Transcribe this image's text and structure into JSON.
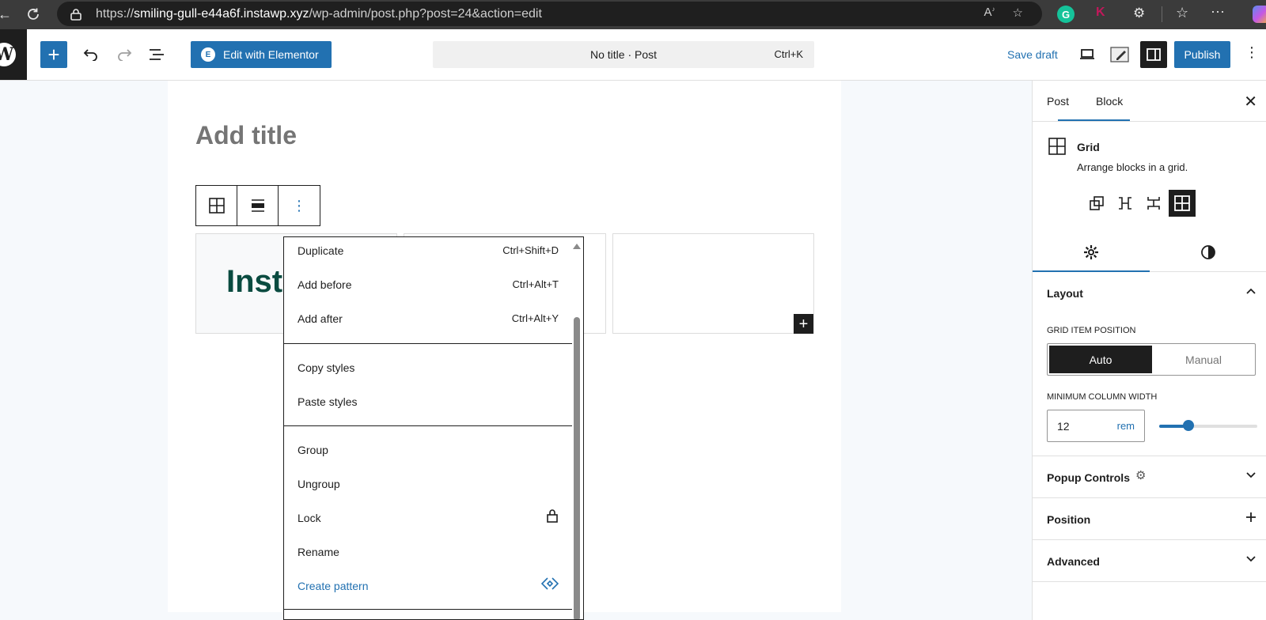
{
  "browser": {
    "url_prefix": "https://",
    "url_host": "smiling-gull-e44a6f.instawp.xyz",
    "url_path": "/wp-admin/post.php?post=24&action=edit"
  },
  "header": {
    "elementor_label": "Edit with Elementor",
    "doc_title": "No title · Post",
    "doc_shortcut": "Ctrl+K",
    "save_draft": "Save draft",
    "publish": "Publish"
  },
  "editor": {
    "title_placeholder": "Add title",
    "cell_heading": "Inst"
  },
  "menu": {
    "items": [
      {
        "label": "Duplicate",
        "shortcut": "Ctrl+Shift+D"
      },
      {
        "label": "Add before",
        "shortcut": "Ctrl+Alt+T"
      },
      {
        "label": "Add after",
        "shortcut": "Ctrl+Alt+Y"
      },
      {
        "label": "Copy styles",
        "shortcut": ""
      },
      {
        "label": "Paste styles",
        "shortcut": ""
      },
      {
        "label": "Group",
        "shortcut": ""
      },
      {
        "label": "Ungroup",
        "shortcut": ""
      },
      {
        "label": "Lock",
        "shortcut": ""
      },
      {
        "label": "Rename",
        "shortcut": ""
      },
      {
        "label": "Create pattern",
        "shortcut": ""
      }
    ]
  },
  "sidebar": {
    "tabs": [
      "Post",
      "Block"
    ],
    "active_tab": "Block",
    "block_name": "Grid",
    "block_desc": "Arrange blocks in a grid.",
    "layout": {
      "title": "Layout",
      "position_label": "GRID ITEM POSITION",
      "options": [
        "Auto",
        "Manual"
      ],
      "selected": "Auto",
      "min_col_label": "MINIMUM COLUMN WIDTH",
      "min_col_value": "12",
      "min_col_unit": "rem",
      "slider_fraction": 0.3
    },
    "panels": [
      "Popup Controls",
      "Position",
      "Advanced"
    ]
  },
  "colors": {
    "accent": "#2271b1",
    "dark": "#1e1e1e",
    "heading_green": "#0a4b40"
  }
}
